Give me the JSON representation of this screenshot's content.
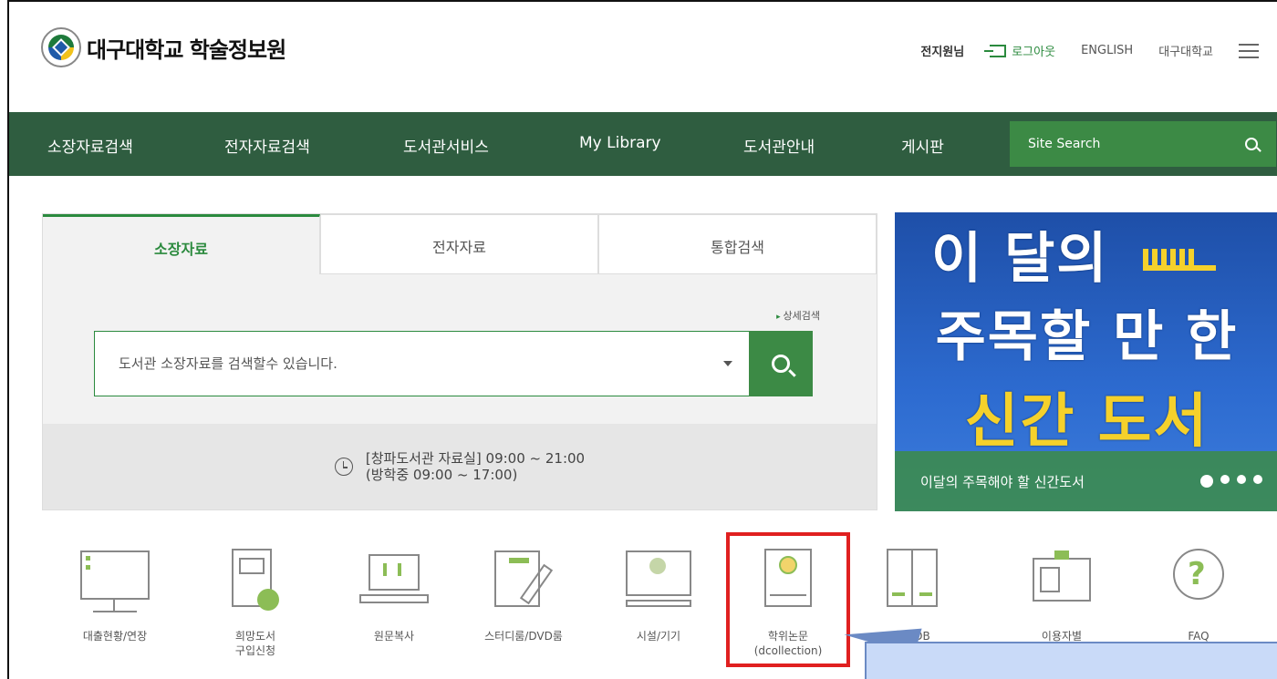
{
  "header": {
    "logo_title": "대구대학교 학술정보원",
    "user_greeting": "전지원님",
    "logout": "로그아웃",
    "english": "ENGLISH",
    "university": "대구대학교"
  },
  "nav": {
    "items": [
      "소장자료검색",
      "전자자료검색",
      "도서관서비스",
      "My Library",
      "도서관안내",
      "게시판"
    ],
    "site_search_placeholder": "Site Search"
  },
  "search_panel": {
    "tabs": [
      "소장자료",
      "전자자료",
      "통합검색"
    ],
    "active_tab": "소장자료",
    "advanced_link": "상세검색",
    "placeholder": "도서관 소장자료를 검색할수 있습니다.",
    "hours_line1": "[창파도서관 자료실] 09:00 ~ 21:00",
    "hours_line2": "(방학중 09:00 ~ 17:00)"
  },
  "banner": {
    "line1": "이 달의",
    "line2": "주목할 만 한",
    "line3": "신간 도서",
    "caption": "이달의 주목해야 할 신간도서"
  },
  "quick_menu": [
    {
      "label": "대출현황/연장",
      "icon": "monitor-icon"
    },
    {
      "label": "희망도서\n구입신청",
      "icon": "book-request-icon"
    },
    {
      "label": "원문복사",
      "icon": "laptop-copy-icon"
    },
    {
      "label": "스터디룸/DVD룸",
      "icon": "room-reservation-icon"
    },
    {
      "label": "시설/기기",
      "icon": "facility-monitor-icon"
    },
    {
      "label": "학위논문\n(dcollection)",
      "icon": "thesis-certificate-icon"
    },
    {
      "label": "학술DB",
      "icon": "database-book-icon"
    },
    {
      "label": "이용자별\n이용안내",
      "icon": "user-id-card-icon"
    },
    {
      "label": "FAQ",
      "icon": "faq-bubble-icon"
    }
  ],
  "colors": {
    "nav_bg": "#2f5d40",
    "accent_green": "#3c8a45",
    "highlight_red": "#e02020",
    "banner_blue": "#2d6bd0",
    "banner_yellow": "#f5d12b"
  }
}
